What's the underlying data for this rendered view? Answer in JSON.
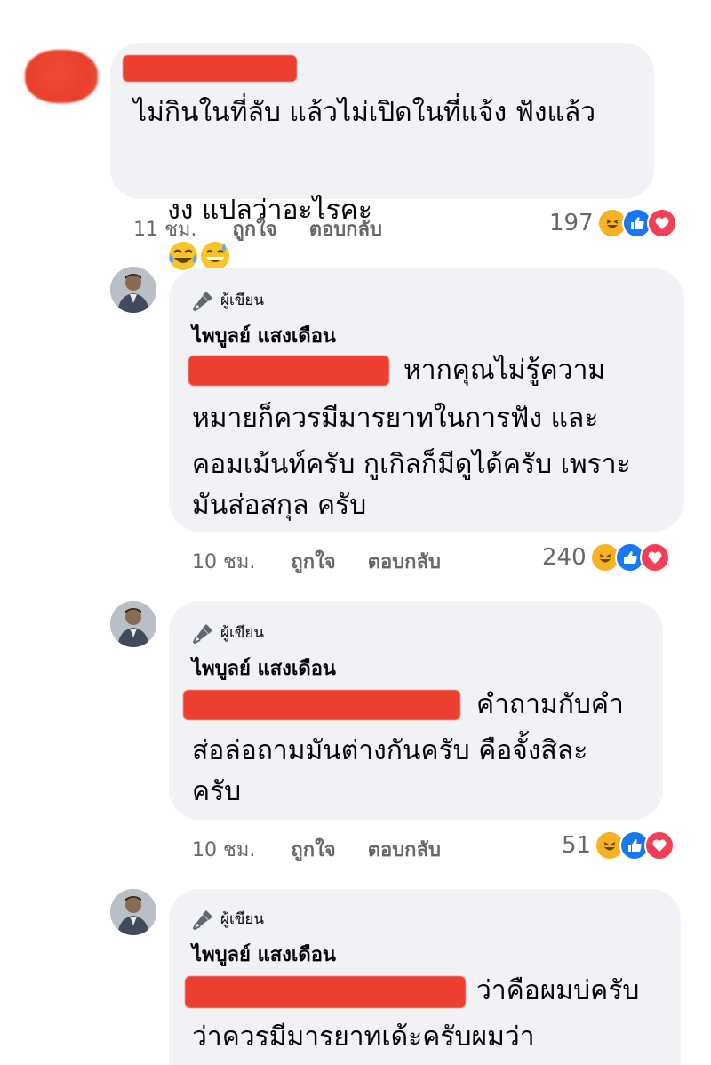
{
  "comments": [
    {
      "text_line1": "ไม่กินในที่ลับ แล้วไม่เปิดในที่แจ้ง ฟังแล้ว",
      "text_line2": "งง แปลว่าอะไรคะ",
      "emojis": [
        "tears-of-joy-emoji",
        "grinning-sweat-emoji"
      ],
      "time": "11 ชม.",
      "like_label": "ถูกใจ",
      "reply_label": "ตอบกลับ",
      "reaction_count": "197"
    },
    {
      "badge": "ผู้เขียน",
      "author": "ไพบูลย์ แสงเดือน",
      "text_line1": "หากคุณไม่รู้ความ",
      "text_line2": "หมายก็ควรมีมารยาทในการฟัง และ",
      "text_line3": "คอมเม้นท์ครับ กูเกิลก็มีดูได้ครับ เพราะ",
      "text_line4": "มันส่อสกุล ครับ",
      "time": "10 ชม.",
      "like_label": "ถูกใจ",
      "reply_label": "ตอบกลับ",
      "reaction_count": "240"
    },
    {
      "badge": "ผู้เขียน",
      "author": "ไพบูลย์ แสงเดือน",
      "text_line1": "คำถามกับคำ",
      "text_line2": "ส่อล่อถามมันต่างกันครับ คือจั้งสิละ",
      "text_line3": "ครับ",
      "time": "10 ชม.",
      "like_label": "ถูกใจ",
      "reply_label": "ตอบกลับ",
      "reaction_count": "51"
    },
    {
      "badge": "ผู้เขียน",
      "author": "ไพบูลย์ แสงเดือน",
      "text_line1": "ว่าคือผมบ่ครับ",
      "text_line2": "ว่าควรมีมารยาทเด้ะครับผมว่า"
    }
  ],
  "reactions": [
    "haha-icon",
    "like-icon",
    "love-icon"
  ],
  "colors": {
    "bubble": "#f0f2f5",
    "redaction": "#ec3f2f",
    "meta": "#65676b",
    "like": "#1877f2",
    "love": "#f33e58",
    "haha": "#f7b125"
  }
}
